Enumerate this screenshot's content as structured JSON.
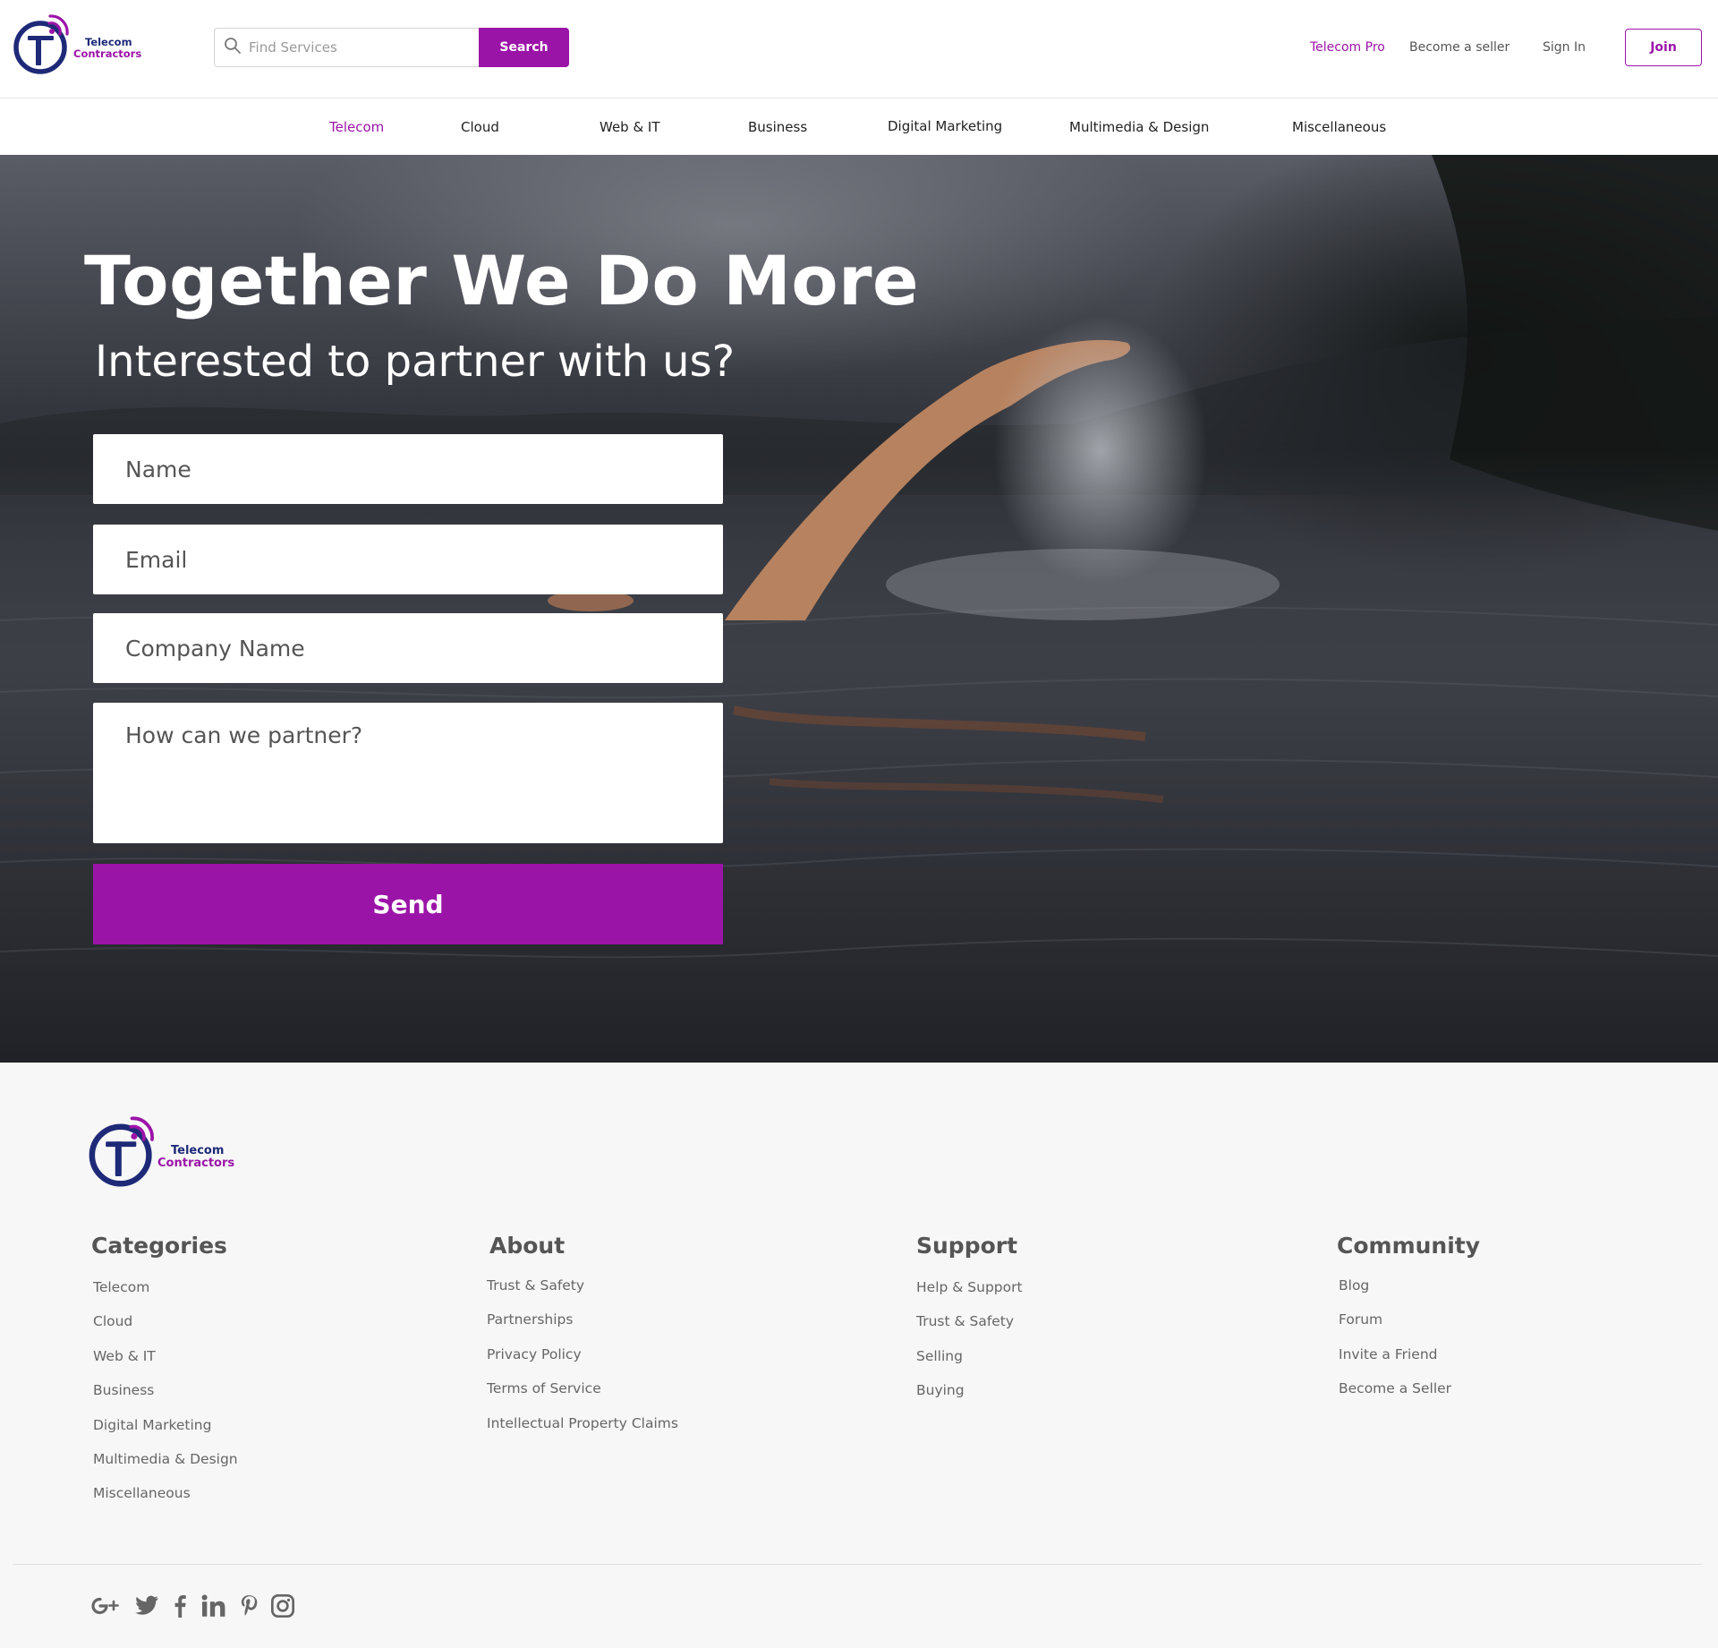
{
  "brand": {
    "line1": "Telecom",
    "line2": "Contractors",
    "colors": {
      "primary": "#9b14a8",
      "navy": "#1e2a78"
    }
  },
  "header": {
    "search": {
      "placeholder": "Find Services",
      "icon": "search-icon",
      "button_label": "Search"
    },
    "links": {
      "pro": "Telecom Pro",
      "seller": "Become a seller",
      "signin": "Sign In",
      "join": "Join"
    }
  },
  "nav": {
    "items": [
      {
        "label": "Telecom",
        "active": true
      },
      {
        "label": "Cloud"
      },
      {
        "label": "Web & IT"
      },
      {
        "label": "Business"
      },
      {
        "label": "Digital Marketing"
      },
      {
        "label": "Multimedia & Design"
      },
      {
        "label": "Miscellaneous"
      }
    ]
  },
  "hero": {
    "title": "Together We Do More",
    "subtitle": "Interested to partner with us?",
    "form": {
      "name_placeholder": "Name",
      "email_placeholder": "Email",
      "company_placeholder": "Company Name",
      "message_placeholder": "How can we partner?",
      "send_label": "Send"
    }
  },
  "footer": {
    "columns": [
      {
        "title": "Categories",
        "items": [
          "Telecom",
          "Cloud",
          "Web & IT",
          "Business",
          "Digital Marketing",
          "Multimedia & Design",
          "Miscellaneous"
        ]
      },
      {
        "title": "About",
        "items": [
          "Trust & Safety",
          "Partnerships",
          "Privacy Policy",
          "Terms of Service",
          "Intellectual Property Claims"
        ]
      },
      {
        "title": "Support",
        "items": [
          "Help & Support",
          "Trust & Safety",
          "Selling",
          "Buying"
        ]
      },
      {
        "title": "Community",
        "items": [
          "Blog",
          "Forum",
          "Invite a Friend",
          "Become a Seller"
        ]
      }
    ],
    "socials": [
      "google-plus-icon",
      "twitter-icon",
      "facebook-icon",
      "linkedin-icon",
      "pinterest-icon",
      "instagram-icon"
    ]
  }
}
